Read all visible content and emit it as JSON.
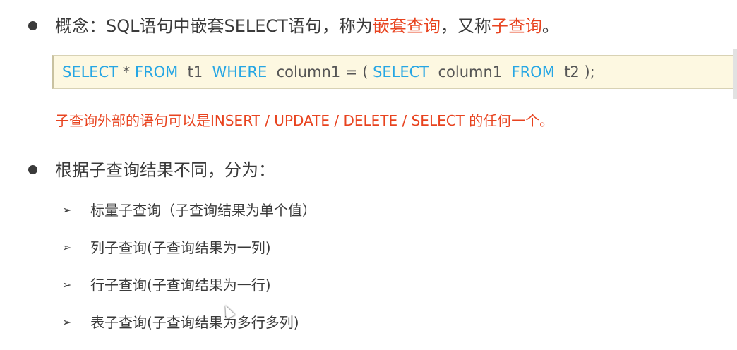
{
  "concept": {
    "label": "概念：SQL语句中嵌套SELECT语句，称为",
    "term1": "嵌套查询",
    "middle": "，又称",
    "term2": "子查询",
    "end": "。"
  },
  "code": {
    "tokens": [
      {
        "text": "SELECT",
        "type": "keyword"
      },
      {
        "text": " * ",
        "type": "text"
      },
      {
        "text": "FROM",
        "type": "keyword"
      },
      {
        "text": "  t1  ",
        "type": "text"
      },
      {
        "text": "WHERE",
        "type": "keyword"
      },
      {
        "text": "  column1 = ( ",
        "type": "text"
      },
      {
        "text": "SELECT",
        "type": "keyword"
      },
      {
        "text": "  column1  ",
        "type": "text"
      },
      {
        "text": "FROM",
        "type": "keyword"
      },
      {
        "text": "  t2 );",
        "type": "text"
      }
    ]
  },
  "note": "子查询外部的语句可以是INSERT / UPDATE / DELETE / SELECT 的任何一个。",
  "classification": {
    "heading": "根据子查询结果不同，分为：",
    "items": [
      {
        "label": "标量子查询（子查询结果为单个值）"
      },
      {
        "label": "列子查询(子查询结果为一列)"
      },
      {
        "label": "行子查询(子查询结果为一行)"
      },
      {
        "label": "表子查询(子查询结果为多行多列)"
      }
    ]
  },
  "colors": {
    "highlight": "#e8431f",
    "keyword": "#26a6e4",
    "code_bg": "#fdf8e1"
  },
  "icons": {
    "bullet": "bullet-dot-icon",
    "arrow": "arrow-bullet-icon"
  }
}
